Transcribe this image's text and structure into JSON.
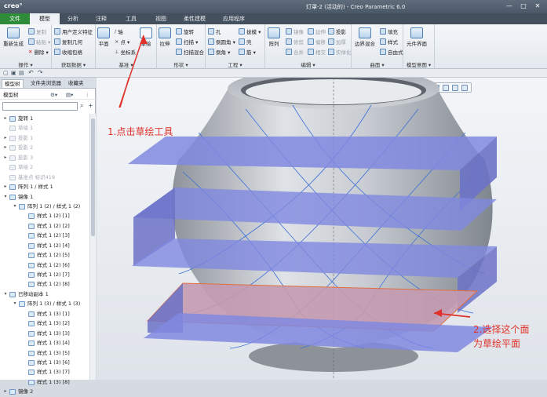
{
  "app": {
    "logo": "creo°",
    "window_title": "灯罩-2 (活动的) - Creo Parametric 6.0",
    "window_buttons": [
      "—",
      "□",
      "✕"
    ],
    "quick_access_icons": [
      "new-icon",
      "open-icon",
      "save-icon",
      "undo-icon",
      "redo-icon"
    ]
  },
  "tabs": [
    "文件",
    "模型",
    "分析",
    "注释",
    "工具",
    "视图",
    "柔性建模",
    "应用程序"
  ],
  "active_tab": "模型",
  "ribbon": {
    "groups": [
      {
        "label": "操作 ▾",
        "items": [
          "重新生成",
          "复制",
          "粘贴 ▾",
          "删除 ▾"
        ]
      },
      {
        "label": "获取数据 ▾",
        "items": [
          "用户定义特征",
          "复制几何",
          "收缩包络"
        ]
      },
      {
        "label": "基准 ▾",
        "items": [
          "平面",
          "轴",
          "点 ▾",
          "坐标系",
          "草绘"
        ]
      },
      {
        "label": "形状 ▾",
        "items": [
          "拉伸",
          "旋转",
          "扫描 ▾",
          "扫描混合"
        ]
      },
      {
        "label": "工程 ▾",
        "items": [
          "孔",
          "倒圆角 ▾",
          "倒角 ▾",
          "拔模 ▾",
          "壳",
          "筋 ▾"
        ]
      },
      {
        "label": "编辑 ▾",
        "items": [
          "阵列",
          "镜像",
          "延伸",
          "投影",
          "修剪",
          "偏移",
          "加厚",
          "合并",
          "相交",
          "实体化"
        ]
      },
      {
        "label": "曲面 ▾",
        "items": [
          "边界混合",
          "填充",
          "样式",
          "自由式"
        ]
      },
      {
        "label": "模型意图 ▾",
        "items": [
          "元件界面"
        ]
      }
    ]
  },
  "left_panel": {
    "tabs": [
      "模型树",
      "文件夹浏览器",
      "收藏夹"
    ],
    "tree_header": "模型树",
    "filter_placeholder": "",
    "rows": [
      {
        "label": "旋转 1",
        "indent": 0,
        "toggle": "▸",
        "dim": false
      },
      {
        "label": "草绘 1",
        "indent": 0,
        "toggle": "",
        "dim": true
      },
      {
        "label": "投影 1",
        "indent": 0,
        "toggle": "▸",
        "dim": true
      },
      {
        "label": "投影 2",
        "indent": 0,
        "toggle": "▸",
        "dim": true
      },
      {
        "label": "投影 3",
        "indent": 0,
        "toggle": "▸",
        "dim": true
      },
      {
        "label": "草绘 2",
        "indent": 0,
        "toggle": "",
        "dim": true
      },
      {
        "label": "基准点 标识419",
        "indent": 0,
        "toggle": "",
        "dim": true
      },
      {
        "label": "阵列 1 / 样式 1",
        "indent": 0,
        "toggle": "▸",
        "dim": false
      },
      {
        "label": "镜像 1",
        "indent": 0,
        "toggle": "▾",
        "dim": false
      },
      {
        "label": "阵列 1 (2) / 样式 1 (2)",
        "indent": 1,
        "toggle": "▾",
        "dim": false
      },
      {
        "label": "样式 1 (2) [1]",
        "indent": 2,
        "toggle": "",
        "dim": false
      },
      {
        "label": "样式 1 (2) [2]",
        "indent": 2,
        "toggle": "",
        "dim": false
      },
      {
        "label": "样式 1 (2) [3]",
        "indent": 2,
        "toggle": "",
        "dim": false
      },
      {
        "label": "样式 1 (2) [4]",
        "indent": 2,
        "toggle": "",
        "dim": false
      },
      {
        "label": "样式 1 (2) [5]",
        "indent": 2,
        "toggle": "",
        "dim": false
      },
      {
        "label": "样式 1 (2) [6]",
        "indent": 2,
        "toggle": "",
        "dim": false
      },
      {
        "label": "样式 1 (2) [7]",
        "indent": 2,
        "toggle": "",
        "dim": false
      },
      {
        "label": "样式 1 (2) [8]",
        "indent": 2,
        "toggle": "",
        "dim": false
      },
      {
        "label": "已移动副本 1",
        "indent": 0,
        "toggle": "▾",
        "dim": false
      },
      {
        "label": "阵列 1 (3) / 样式 1 (3)",
        "indent": 1,
        "toggle": "▾",
        "dim": false
      },
      {
        "label": "样式 1 (3) [1]",
        "indent": 2,
        "toggle": "",
        "dim": false
      },
      {
        "label": "样式 1 (3) [2]",
        "indent": 2,
        "toggle": "",
        "dim": false
      },
      {
        "label": "样式 1 (3) [3]",
        "indent": 2,
        "toggle": "",
        "dim": false
      },
      {
        "label": "样式 1 (3) [4]",
        "indent": 2,
        "toggle": "",
        "dim": false
      },
      {
        "label": "样式 1 (3) [5]",
        "indent": 2,
        "toggle": "",
        "dim": false
      },
      {
        "label": "样式 1 (3) [6]",
        "indent": 2,
        "toggle": "",
        "dim": false
      },
      {
        "label": "样式 1 (3) [7]",
        "indent": 2,
        "toggle": "",
        "dim": false
      },
      {
        "label": "样式 1 (3) [8]",
        "indent": 2,
        "toggle": "",
        "dim": false
      },
      {
        "label": "镜像 2",
        "indent": 0,
        "toggle": "▸",
        "dim": false
      }
    ]
  },
  "annotations": {
    "step1": "1.点击草绘工具",
    "step2_line1": "2.选择这个面",
    "step2_line2": "为草绘平面"
  },
  "colors": {
    "annotation": "#e0322a",
    "plane_fill": "#8088e0",
    "selected_plane_fill": "#c49ab0",
    "model_body": "#b9bdc4",
    "file_tab": "#2e8b3a",
    "curve": "#3a6fd8"
  }
}
